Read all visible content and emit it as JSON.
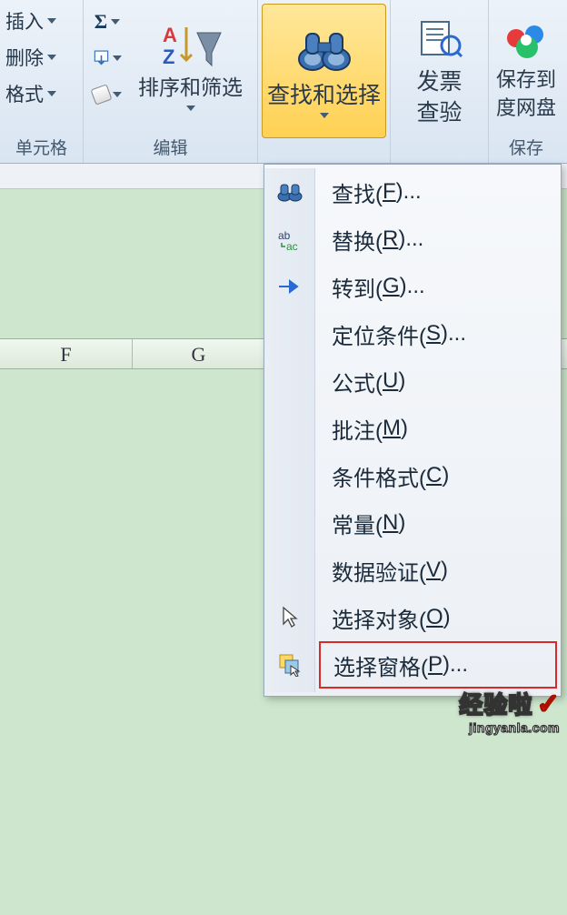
{
  "ribbon": {
    "cells": {
      "insert": "插入",
      "delete": "删除",
      "format": "格式",
      "group_label": "单元格"
    },
    "edit": {
      "sort_filter": "排序和筛选",
      "group_label": "编辑"
    },
    "find_select": {
      "label": "查找和选择"
    },
    "invoice": {
      "line1": "发票",
      "line2": "查验"
    },
    "save": {
      "line1": "保存到",
      "line2": "度网盘",
      "group_label": "保存"
    }
  },
  "columns": [
    "F",
    "G"
  ],
  "menu": {
    "items": [
      {
        "text_pre": "查找(",
        "key": "F",
        "text_post": ")...",
        "icon": "binocular"
      },
      {
        "text_pre": "替换(",
        "key": "R",
        "text_post": ")...",
        "icon": "replace"
      },
      {
        "text_pre": "转到(",
        "key": "G",
        "text_post": ")...",
        "icon": "arrow-right"
      },
      {
        "text_pre": "定位条件(",
        "key": "S",
        "text_post": ")...",
        "icon": ""
      },
      {
        "text_pre": "公式(",
        "key": "U",
        "text_post": ")",
        "icon": ""
      },
      {
        "text_pre": "批注(",
        "key": "M",
        "text_post": ")",
        "icon": ""
      },
      {
        "text_pre": "条件格式(",
        "key": "C",
        "text_post": ")",
        "icon": ""
      },
      {
        "text_pre": "常量(",
        "key": "N",
        "text_post": ")",
        "icon": ""
      },
      {
        "text_pre": "数据验证(",
        "key": "V",
        "text_post": ")",
        "icon": ""
      },
      {
        "text_pre": "选择对象(",
        "key": "O",
        "text_post": ")",
        "icon": "cursor"
      },
      {
        "text_pre": "选择窗格(",
        "key": "P",
        "text_post": ")...",
        "icon": "pane"
      }
    ]
  },
  "watermark": {
    "brand": "经验啦",
    "url": "jingyanla.com"
  }
}
